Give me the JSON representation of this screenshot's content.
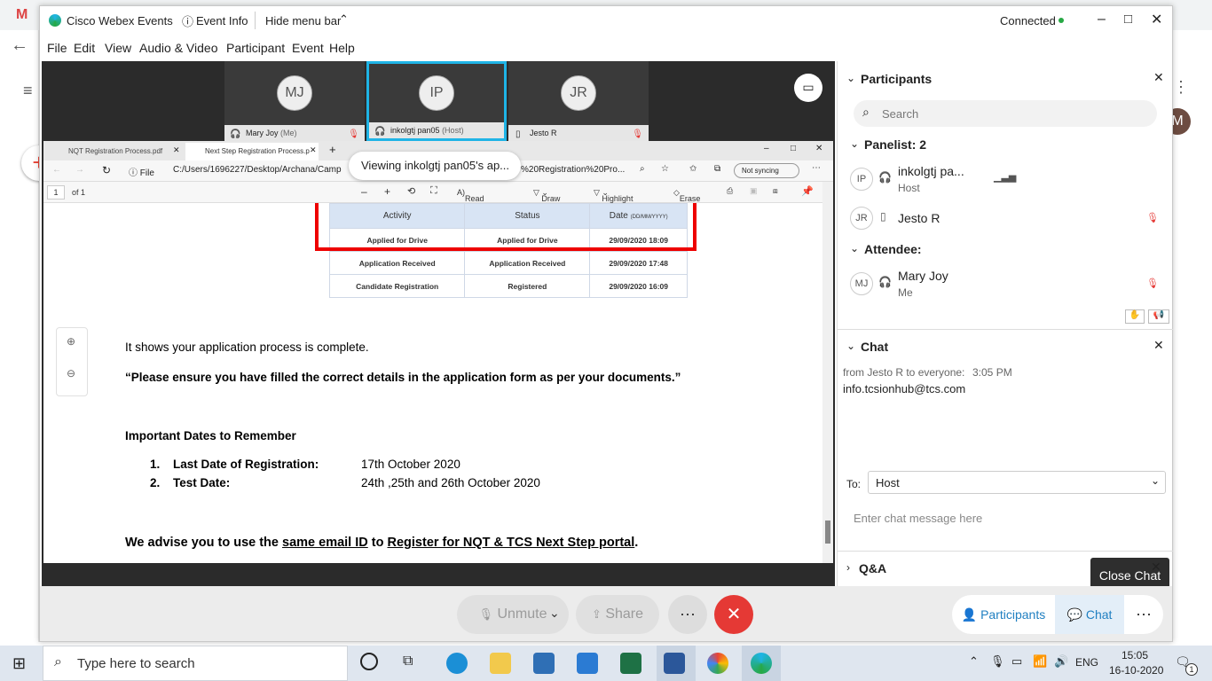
{
  "window": {
    "app_title": "Cisco Webex Events",
    "event_info": "Event Info",
    "hide_menu_bar": "Hide menu bar",
    "status": "Connected"
  },
  "menu": [
    "File",
    "Edit",
    "View",
    "Audio & Video",
    "Participant",
    "Event",
    "Help"
  ],
  "tiles": [
    {
      "initials": "MJ",
      "label": "Mary Joy",
      "sub": "(Me)"
    },
    {
      "initials": "IP",
      "label": "inkolgtj pan05",
      "sub": "(Host)"
    },
    {
      "initials": "JR",
      "label": "Jesto R",
      "sub": ""
    }
  ],
  "shared": {
    "tab1": "NQT Registration Process.pdf",
    "tab2": "Next Step Registration Process.p",
    "address": "C:/Users/1696227/Desktop/Archana/Camp",
    "address_tail": "%20Registration%20Pro...",
    "viewing": "Viewing inkolgtj pan05's ap...",
    "not_syncing": "Not syncing",
    "file_label": "File",
    "page": "1",
    "of_pages": "of 1",
    "read_aloud": "Read aloud",
    "draw": "Draw",
    "highlight": "Highlight",
    "erase": "Erase"
  },
  "doc": {
    "table_headers": [
      "Activity",
      "Status",
      "Date"
    ],
    "date_hint": "(DD/MM/YYYY)",
    "rows": [
      [
        "Applied for Drive",
        "Applied for Drive",
        "29/09/2020 18:09"
      ],
      [
        "Application Received",
        "Application Received",
        "29/09/2020 17:48"
      ],
      [
        "Candidate Registration",
        "Registered",
        "29/09/2020 16:09"
      ]
    ],
    "line1": "It shows your application process is complete.",
    "quote": "“Please ensure you have filled the correct details in the application form as per your documents.”",
    "dates_heading": "Important Dates to Remember",
    "item1_num": "1.",
    "item1_label": "Last Date of Registration:",
    "item1_value": "17th October 2020",
    "item2_num": "2.",
    "item2_label": "Test Date:",
    "item2_value": "24th ,25th and 26th October 2020",
    "advice_a": "We advise you to use the ",
    "advice_b": "same email ID",
    "advice_c": " to ",
    "advice_d": "Register for NQT & TCS Next Step portal",
    "advice_e": "."
  },
  "controls": {
    "unmute": "Unmute",
    "share": "Share",
    "participants": "Participants",
    "chat": "Chat"
  },
  "participants_panel": {
    "title": "Participants",
    "search_placeholder": "Search",
    "panelist_heading": "Panelist: 2",
    "host_name": "inkolgtj pa...",
    "host_role": "Host",
    "host_initials": "IP",
    "jesto_name": "Jesto R",
    "jesto_initials": "JR",
    "attendee_heading": "Attendee:",
    "mary_name": "Mary Joy",
    "mary_role": "Me",
    "mary_initials": "MJ"
  },
  "chat_panel": {
    "title": "Chat",
    "from": "from Jesto R to everyone:",
    "time": "3:05 PM",
    "message": "info.tcsionhub@tcs.com",
    "to_label": "To:",
    "to_value": "Host",
    "input_placeholder": "Enter chat message here",
    "qa": "Q&A",
    "tooltip": "Close Chat"
  },
  "taskbar": {
    "search_placeholder": "Type here to search",
    "lang": "ENG",
    "time": "15:05",
    "date": "16-10-2020",
    "notif": "1"
  },
  "colors": {
    "accent": "#1fb4e6",
    "red": "#e53935",
    "webex_green": "#27a844"
  }
}
